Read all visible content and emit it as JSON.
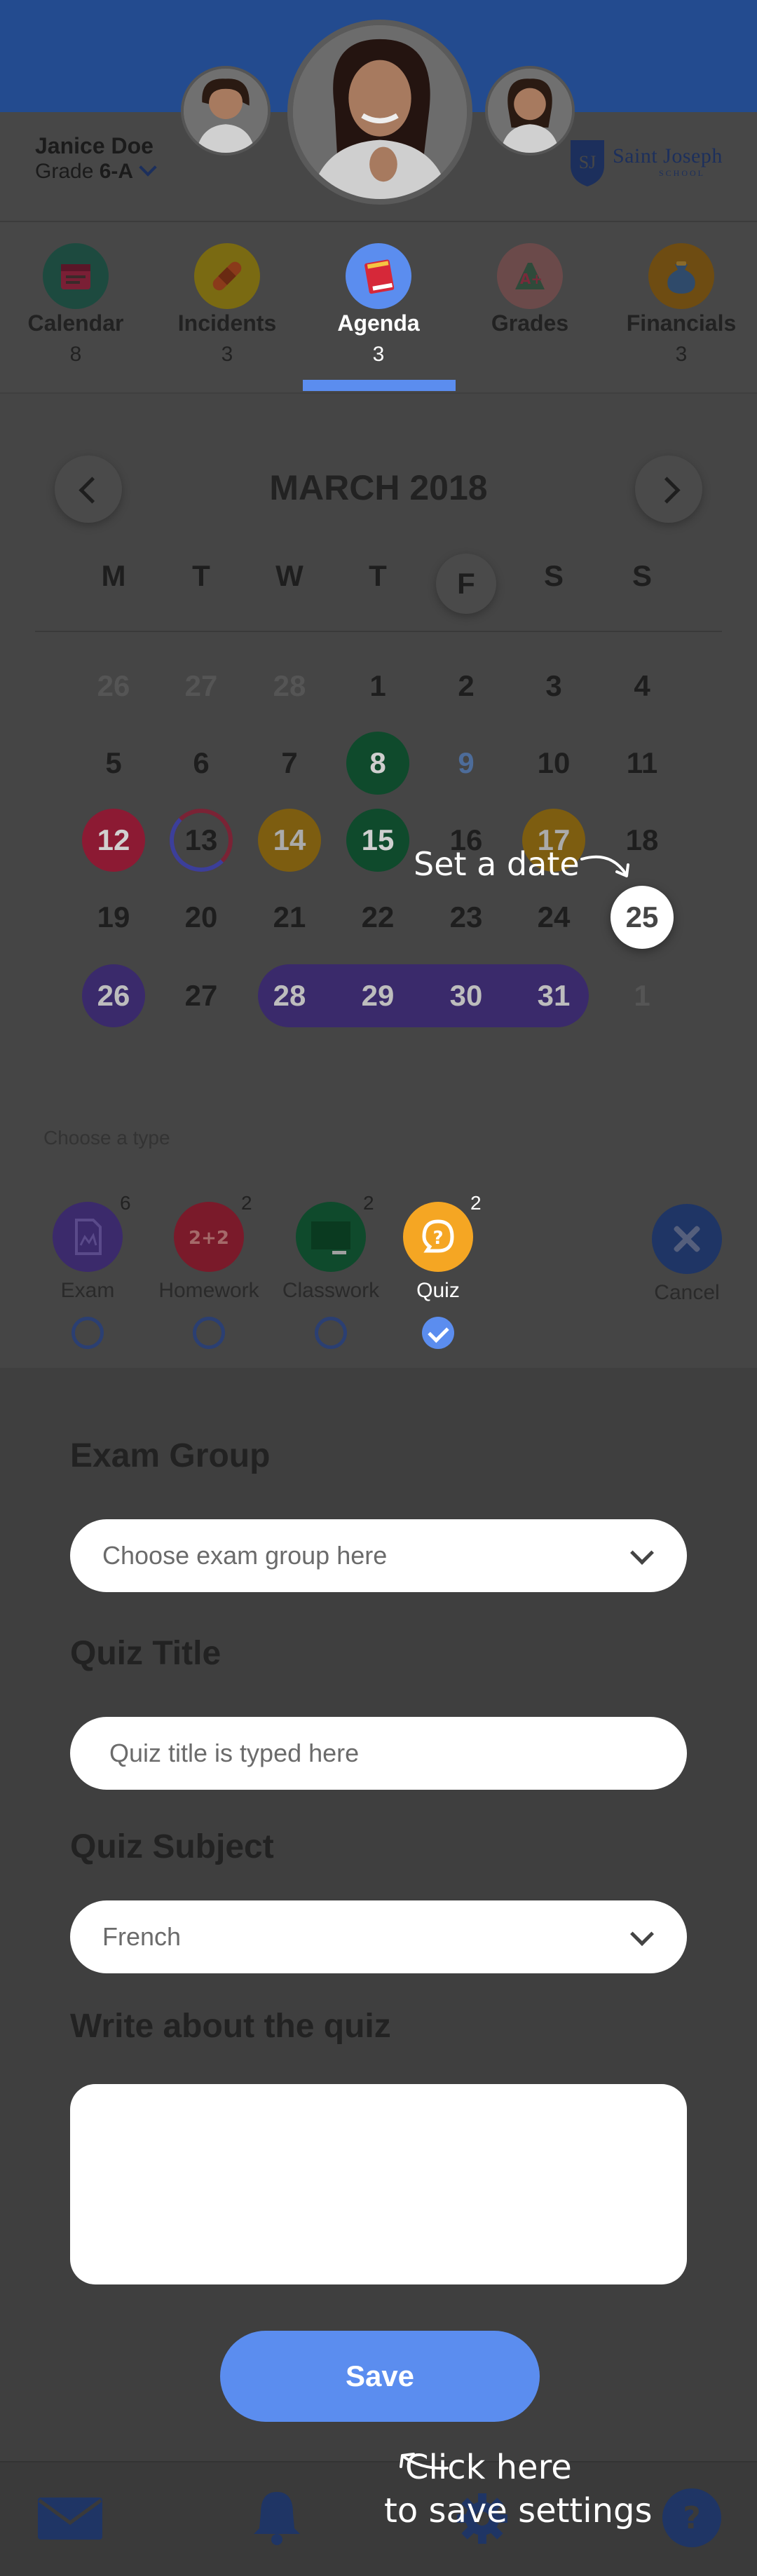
{
  "student": {
    "name": "Janice Doe",
    "grade_prefix": "Grade",
    "grade": "6-A"
  },
  "school": {
    "name": "Saint Joseph",
    "sub": "SCHOOL",
    "monogram": "SJ"
  },
  "tabs": [
    {
      "label": "Calendar",
      "count": "8",
      "icon": "calendar-icon",
      "color": "#1d4a3f"
    },
    {
      "label": "Incidents",
      "count": "3",
      "icon": "bandage-icon",
      "color": "#7a6a12"
    },
    {
      "label": "Agenda",
      "count": "3",
      "icon": "book-icon",
      "color": "#5b8def"
    },
    {
      "label": "Grades",
      "count": "",
      "icon": "grades-icon",
      "color": "#6b4a4a"
    },
    {
      "label": "Financials",
      "count": "3",
      "icon": "money-bag-icon",
      "color": "#6e4c12"
    }
  ],
  "calendar": {
    "month": "MARCH 2018",
    "weekdays": [
      "M",
      "T",
      "W",
      "T",
      "F",
      "S",
      "S"
    ],
    "weeks": [
      [
        "26",
        "27",
        "28",
        "1",
        "2",
        "3",
        "4"
      ],
      [
        "5",
        "6",
        "7",
        "8",
        "9",
        "10",
        "11"
      ],
      [
        "12",
        "13",
        "14",
        "15",
        "16",
        "17",
        "18"
      ],
      [
        "19",
        "20",
        "21",
        "22",
        "23",
        "24",
        "25"
      ],
      [
        "26",
        "27",
        "28",
        "29",
        "30",
        "31",
        "1"
      ]
    ],
    "selected_day": "25",
    "hint": "Set a date"
  },
  "types": {
    "title": "Choose a type",
    "items": [
      {
        "label": "Exam",
        "count": "6",
        "icon": "exam-icon",
        "color": "#3b2a6b"
      },
      {
        "label": "Homework",
        "count": "2",
        "icon": "homework-icon",
        "color": "#7a1a2a"
      },
      {
        "label": "Classwork",
        "count": "2",
        "icon": "chalkboard-icon",
        "color": "#0f4a2c"
      },
      {
        "label": "Quiz",
        "count": "2",
        "icon": "question-icon",
        "color": "#f5a623"
      }
    ],
    "selected": "Quiz",
    "cancel_label": "Cancel"
  },
  "form": {
    "exam_group": {
      "heading": "Exam Group",
      "placeholder": "Choose exam group here"
    },
    "quiz_title": {
      "heading": "Quiz Title",
      "placeholder": "Quiz title is typed here"
    },
    "quiz_subject": {
      "heading": "Quiz Subject",
      "value": "French"
    },
    "quiz_description": {
      "heading": "Write about the quiz",
      "value": ""
    },
    "save_label": "Save",
    "hint_line1": "Click here",
    "hint_line2": "to save settings"
  },
  "bottom_nav": [
    "mail-icon",
    "bell-icon",
    "gear-icon",
    "help-icon"
  ],
  "colors": {
    "accent": "#5b8def",
    "header": "#234b8f",
    "overlay": "#3f3f3f"
  }
}
